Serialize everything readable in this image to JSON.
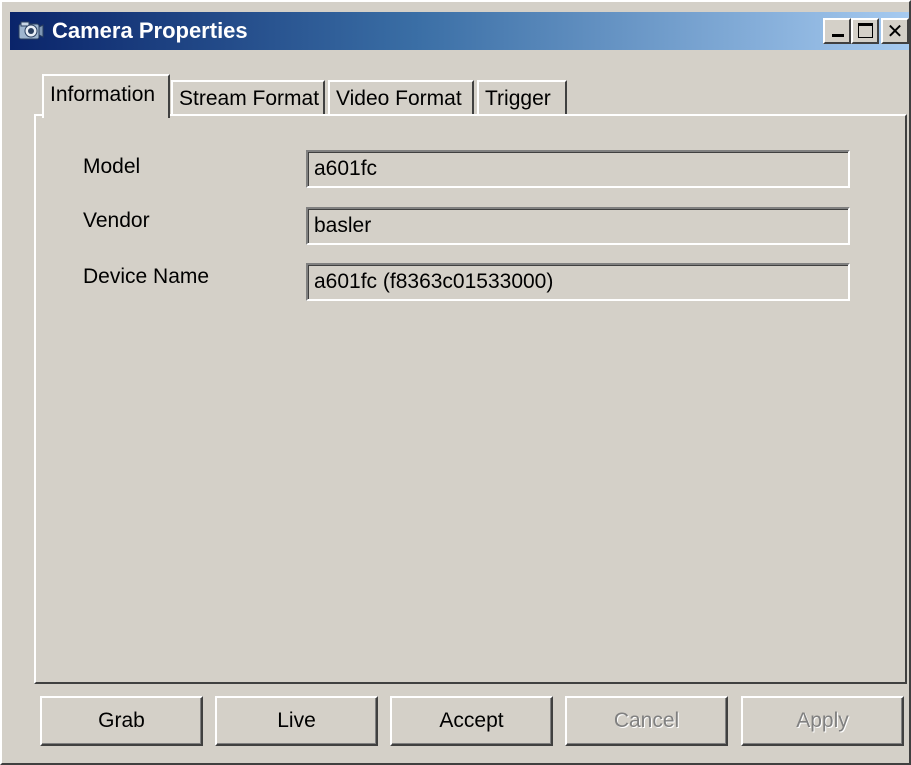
{
  "window": {
    "title": "Camera Properties",
    "icon": "camera-icon",
    "controls": {
      "minimize": "minimize-icon",
      "maximize": "maximize-icon",
      "close": "close-icon"
    }
  },
  "tabs": [
    {
      "label": "Information",
      "active": true
    },
    {
      "label": "Stream Format",
      "active": false
    },
    {
      "label": "Video Format",
      "active": false
    },
    {
      "label": "Trigger",
      "active": false
    }
  ],
  "info": {
    "fields": [
      {
        "label": "Model",
        "value": "a601fc"
      },
      {
        "label": "Vendor",
        "value": "basler"
      },
      {
        "label": "Device Name",
        "value": "a601fc (f8363c01533000)"
      }
    ]
  },
  "buttons": [
    {
      "label": "Grab",
      "enabled": true
    },
    {
      "label": "Live",
      "enabled": true
    },
    {
      "label": "Accept",
      "enabled": true
    },
    {
      "label": "Cancel",
      "enabled": false
    },
    {
      "label": "Apply",
      "enabled": false
    }
  ],
  "colors": {
    "titlebar_start": "#0a246a",
    "titlebar_end": "#a6caf0",
    "face": "#d4d0c8",
    "disabled_text": "#808080"
  }
}
